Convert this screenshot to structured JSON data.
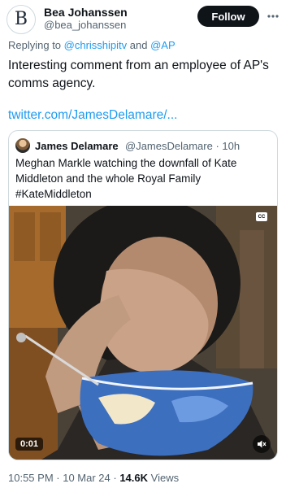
{
  "author": {
    "avatar_letter": "B",
    "name": "Bea Johanssen",
    "handle": "@bea_johanssen",
    "follow_label": "Follow"
  },
  "reply": {
    "prefix": "Replying to ",
    "to1": "@chrisshipitv",
    "and": " and ",
    "to2": "@AP"
  },
  "tweet": {
    "text": "Interesting comment from an employee of AP's comms agency.",
    "link": "twitter.com/JamesDelamare/..."
  },
  "quote": {
    "name": "James Delamare",
    "handle": "@JamesDelamare",
    "sep": " · ",
    "time": "10h",
    "text_line1": "Meghan Markle watching the downfall of Kate",
    "text_line2": "Middleton and the whole Royal Family",
    "text_line3": "#KateMiddleton",
    "video": {
      "cc_label": "CC",
      "timecode": "0:01"
    }
  },
  "footer": {
    "time": "10:55 PM",
    "date": "10 Mar 24",
    "views_count": "14.6K",
    "views_label": "Views",
    "sep": " · "
  },
  "colors": {
    "link": "#1d9bf0",
    "text": "#0f1419",
    "muted": "#536471"
  }
}
